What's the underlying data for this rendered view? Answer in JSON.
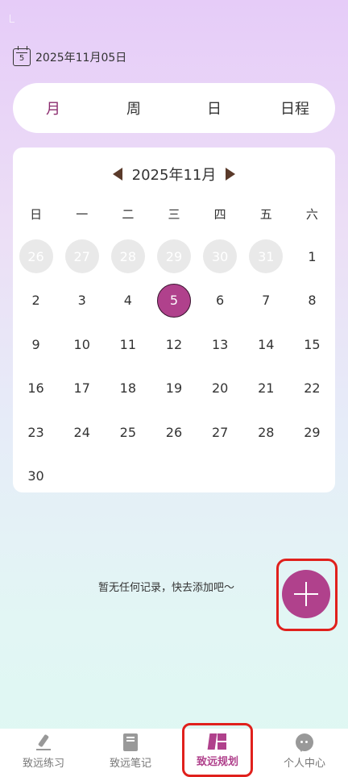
{
  "current_date": {
    "icon_day": "5",
    "text": "2025年11月05日"
  },
  "view_tabs": [
    {
      "label": "月",
      "active": true
    },
    {
      "label": "周",
      "active": false
    },
    {
      "label": "日",
      "active": false
    },
    {
      "label": "日程",
      "active": false
    }
  ],
  "calendar": {
    "month_title": "2025年11月",
    "weekdays": [
      "日",
      "一",
      "二",
      "三",
      "四",
      "五",
      "六"
    ],
    "days": [
      {
        "d": "26",
        "other": true
      },
      {
        "d": "27",
        "other": true
      },
      {
        "d": "28",
        "other": true
      },
      {
        "d": "29",
        "other": true
      },
      {
        "d": "30",
        "other": true
      },
      {
        "d": "31",
        "other": true
      },
      {
        "d": "1"
      },
      {
        "d": "2"
      },
      {
        "d": "3"
      },
      {
        "d": "4"
      },
      {
        "d": "5",
        "selected": true
      },
      {
        "d": "6"
      },
      {
        "d": "7"
      },
      {
        "d": "8"
      },
      {
        "d": "9"
      },
      {
        "d": "10"
      },
      {
        "d": "11"
      },
      {
        "d": "12"
      },
      {
        "d": "13"
      },
      {
        "d": "14"
      },
      {
        "d": "15"
      },
      {
        "d": "16"
      },
      {
        "d": "17"
      },
      {
        "d": "18"
      },
      {
        "d": "19"
      },
      {
        "d": "20"
      },
      {
        "d": "21"
      },
      {
        "d": "22"
      },
      {
        "d": "23"
      },
      {
        "d": "24"
      },
      {
        "d": "25"
      },
      {
        "d": "26"
      },
      {
        "d": "27"
      },
      {
        "d": "28"
      },
      {
        "d": "29"
      },
      {
        "d": "30"
      }
    ]
  },
  "empty_state": {
    "text": "暂无任何记录，快去添加吧～"
  },
  "bottom_nav": [
    {
      "label": "致远练习",
      "icon": "pen-icon",
      "active": false
    },
    {
      "label": "致远笔记",
      "icon": "notebook-icon",
      "active": false
    },
    {
      "label": "致远规划",
      "icon": "plan-icon",
      "active": true
    },
    {
      "label": "个人中心",
      "icon": "chat-bubble-icon",
      "active": false
    }
  ],
  "colors": {
    "accent": "#b0418c",
    "active_tab": "#8b2b6e",
    "highlight_outline": "#e0201c"
  }
}
